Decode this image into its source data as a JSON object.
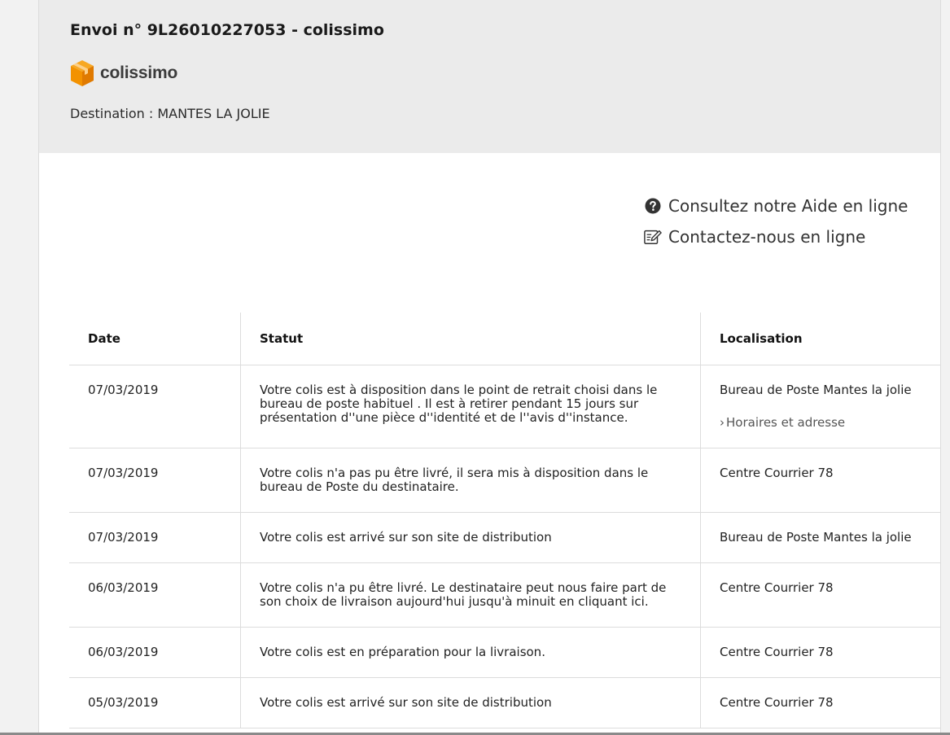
{
  "header": {
    "title": "Envoi n° 9L26010227053 - colissimo",
    "logo_text": "colissimo",
    "destination": "Destination : MANTES LA JOLIE",
    "brand_color": "#f39200"
  },
  "help": {
    "aide_label": "Consultez notre Aide en ligne",
    "aide_icon": "question-circle-icon",
    "contact_label": "Contactez-nous en ligne",
    "contact_icon": "edit-form-icon"
  },
  "table": {
    "headers": {
      "date": "Date",
      "status": "Statut",
      "location": "Localisation"
    },
    "rows": [
      {
        "date": "07/03/2019",
        "status": "Votre colis est à disposition dans le point de retrait choisi dans le bureau de poste habituel . Il est à retirer pendant 15 jours sur présentation d''une pièce d''identité et de l''avis d''instance.",
        "location": "Bureau de Poste Mantes la jolie",
        "link": "Horaires et adresse"
      },
      {
        "date": "07/03/2019",
        "status": "Votre colis n'a pas pu être livré, il sera mis à disposition dans le bureau de Poste du destinataire.",
        "location": "Centre Courrier 78"
      },
      {
        "date": "07/03/2019",
        "status": "Votre colis est arrivé sur son site de distribution",
        "location": "Bureau de Poste Mantes la jolie"
      },
      {
        "date": "06/03/2019",
        "status": "Votre colis n'a pu être livré. Le destinataire peut nous faire part de son choix de livraison aujourd'hui jusqu'à minuit en cliquant ici.",
        "location": "Centre Courrier 78"
      },
      {
        "date": "06/03/2019",
        "status": "Votre colis est en préparation pour la livraison.",
        "location": "Centre Courrier 78"
      },
      {
        "date": "05/03/2019",
        "status": "Votre colis est arrivé sur son site de distribution",
        "location": "Centre Courrier 78"
      }
    ]
  }
}
